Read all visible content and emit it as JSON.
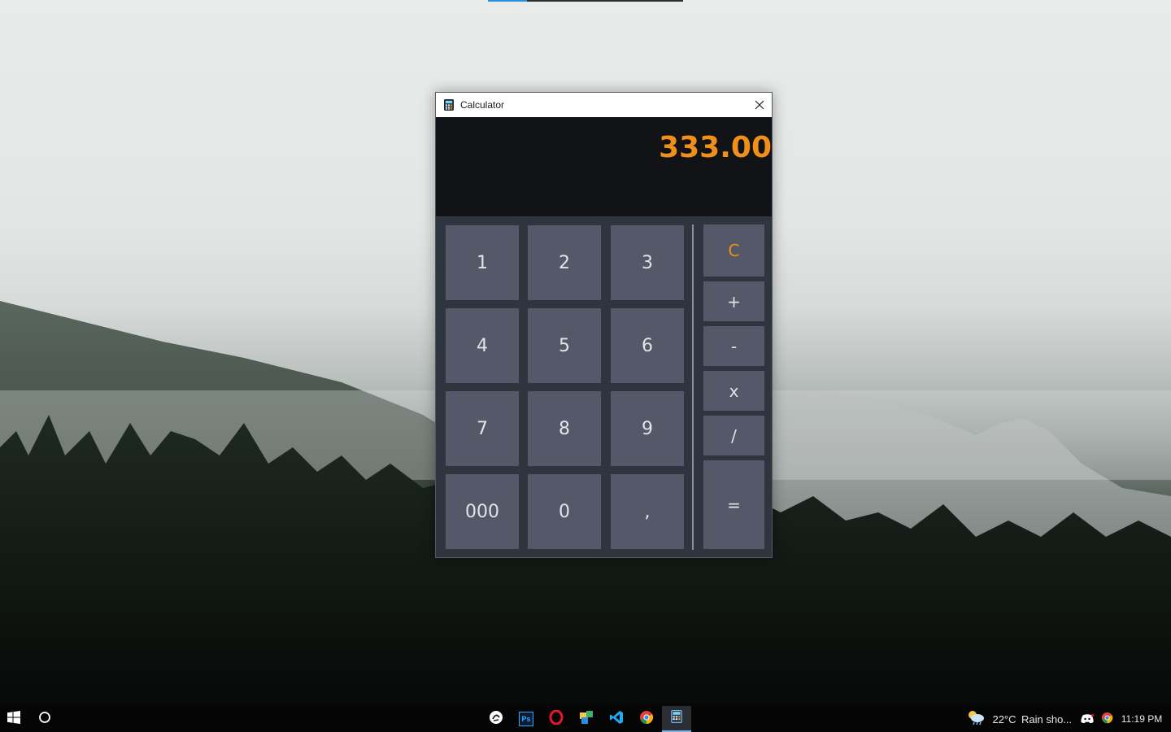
{
  "desktop": {
    "wallpaper": "misty-forest-mountains",
    "progress_fraction": 0.2
  },
  "window": {
    "title": "Calculator",
    "icon": "calculator-icon",
    "close_icon": "close-icon"
  },
  "display": {
    "value": "333.00",
    "color": "#f0901a"
  },
  "keypad": {
    "digits": [
      "1",
      "2",
      "3",
      "4",
      "5",
      "6",
      "7",
      "8",
      "9",
      "000",
      "0",
      ","
    ],
    "clear": "C",
    "plus": "+",
    "minus": "-",
    "multiply": "x",
    "divide": "/",
    "equals": "="
  },
  "taskbar": {
    "start_icon": "windows-start-icon",
    "search_icon": "cortana-circle-icon",
    "apps": [
      "pen-tablet-icon",
      "photoshop-icon",
      "opera-icon",
      "sticky-notes-icon",
      "vscode-icon",
      "chrome-icon",
      "calculator-icon"
    ],
    "photoshop_label": "Ps",
    "weather_temp": "22°C",
    "weather_desc": "Rain sho...",
    "tray_icons": [
      "discord-icon",
      "chrome-icon"
    ],
    "time": "11:19 PM"
  },
  "colors": {
    "accent": "#f0901a",
    "key_bg": "#535968",
    "window_bg": "#2f353e",
    "display_bg": "#111317"
  }
}
